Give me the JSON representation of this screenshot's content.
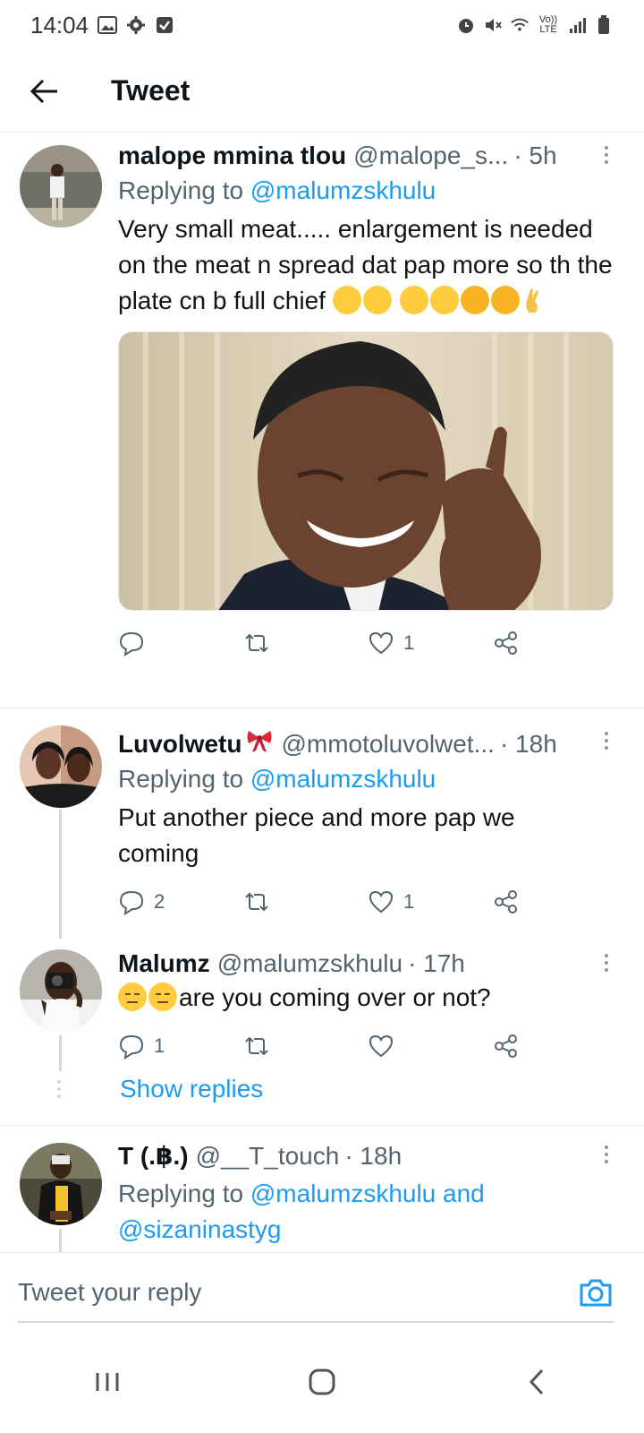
{
  "status_bar": {
    "time": "14:04",
    "left_icons": [
      "image-icon",
      "settings-gear-icon",
      "checkbox-icon"
    ],
    "right_icons": [
      "alarm-icon",
      "mute-icon",
      "wifi-icon",
      "volte-icon",
      "signal-icon",
      "battery-icon"
    ],
    "volte_label": "Vo)) LTE"
  },
  "header": {
    "back_icon": "arrow-left-icon",
    "title": "Tweet"
  },
  "tweets": [
    {
      "name": "malope mmina tlou",
      "handle": "@malope_s...",
      "time": "· 5h",
      "replying_prefix": "Replying to",
      "replying_to": "@malumzskhulu",
      "text": "Very small meat..... enlargement is needed on the meat n spread dat pap more so th the plate cn b full chief",
      "emojis": [
        "face-with-tears-of-joy",
        "face-with-tears-of-joy",
        "face-with-tears-of-joy",
        "face-with-tears-of-joy",
        "rolling-on-floor-laughing",
        "rolling-on-floor-laughing",
        "crossed-fingers"
      ],
      "has_photo": true,
      "photo_description_icon": "laughing-man-photo",
      "replies": "",
      "retweets": "",
      "likes": "1"
    },
    {
      "name": "Luvolwetu",
      "name_emoji": "ribbon",
      "handle": "@mmotoluvolwet...",
      "time": "· 18h",
      "replying_prefix": "Replying to",
      "replying_to": "@malumzskhulu",
      "text": "Put another piece and more pap we coming",
      "replies": "2",
      "retweets": "",
      "likes": "1"
    },
    {
      "name": "Malumz",
      "handle": "@malumzskhulu",
      "time": "· 17h",
      "text": "are you coming over or not?",
      "emojis": [
        "expressionless-face",
        "expressionless-face"
      ],
      "replies": "1",
      "retweets": "",
      "likes": ""
    },
    {
      "name": "T (.฿.)",
      "handle": "@__T_touch",
      "time": "· 18h",
      "replying_prefix": "Replying to",
      "replying_to": "@malumzskhulu",
      "replying_and": "and",
      "replying_to_2": "@sizaninastyg"
    }
  ],
  "show_replies": "Show replies",
  "composer": {
    "placeholder": "Tweet your reply",
    "camera_icon": "camera-icon"
  },
  "nav_bar": {
    "icons": [
      "recent-apps-icon",
      "home-icon",
      "back-icon"
    ]
  },
  "colors": {
    "accent": "#1d9bf0",
    "text": "#0f1419",
    "secondary": "#536471",
    "divider": "#e6ecf0"
  }
}
